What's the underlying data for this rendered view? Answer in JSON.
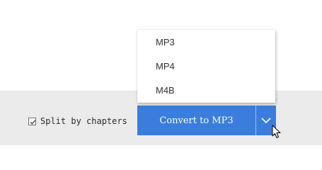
{
  "dropdown": {
    "items": [
      {
        "label": "MP3"
      },
      {
        "label": "MP4"
      },
      {
        "label": "M4B"
      }
    ]
  },
  "footer": {
    "split_by_chapters": {
      "label": "Split by chapters",
      "checked": true
    },
    "convert_button": {
      "label": "Convert to MP3"
    },
    "format_toggle_icon": "chevron-down-icon"
  },
  "colors": {
    "accent": "#3b7ddd",
    "bottom_bar": "#ebebeb"
  }
}
